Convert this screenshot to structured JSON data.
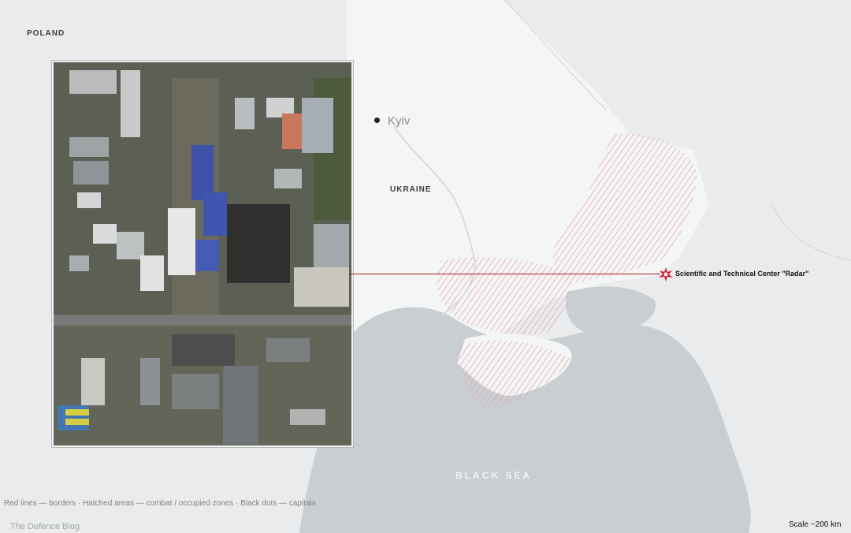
{
  "map": {
    "countries": {
      "poland": "POLAND",
      "ukraine": "UKRAINE"
    },
    "city": "Kyiv",
    "sea": "BLACK SEA",
    "target": {
      "label": "Scientific and Technical Center \"Radar\"",
      "icon": "explosion-icon",
      "color": "#d4213a"
    },
    "legend": "Red lines — borders · Hatched areas — combat / occupied zones · Black dots — capitals",
    "credit": "The Defence Blog",
    "scale": "Scale ~200 km",
    "colors": {
      "land": "#e8eaeb",
      "ukraine": "#f3f4f4",
      "sea": "#c9cfd3",
      "hatch": "#e7b7bd",
      "leader": "#b0182a"
    }
  }
}
